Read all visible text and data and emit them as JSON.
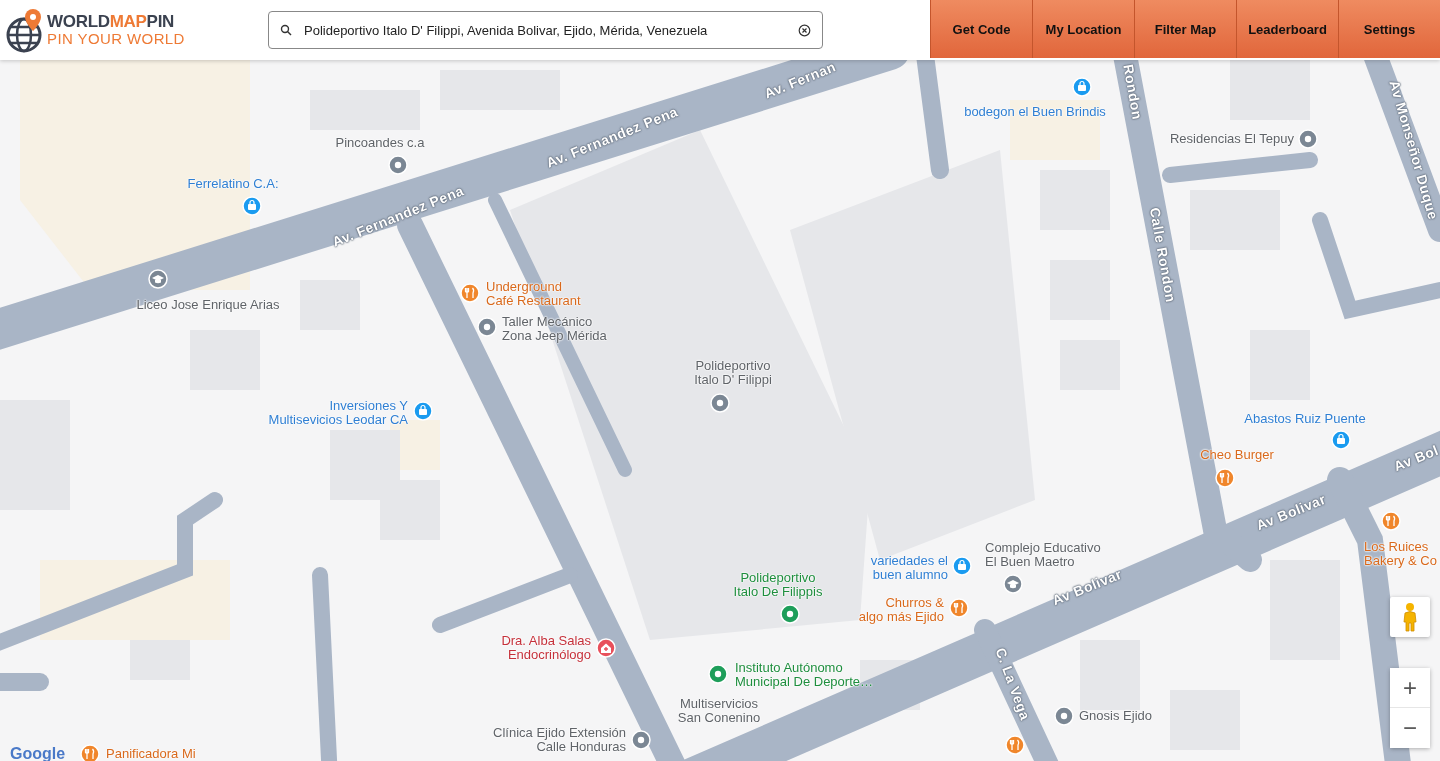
{
  "header": {
    "logo": {
      "brand_dark": "WORLD",
      "brand_accent": "MAP",
      "brand_end": "PIN",
      "tagline": "PIN YOUR WORLD"
    },
    "search": {
      "value": "Polideportivo Italo D' Filippi, Avenida Bolivar, Ejido, Mérida, Venezuela"
    },
    "nav": [
      {
        "label": "Get Code"
      },
      {
        "label": "My Location"
      },
      {
        "label": "Filter Map"
      },
      {
        "label": "Leaderboard"
      },
      {
        "label": "Settings"
      }
    ]
  },
  "map": {
    "road_labels": [
      "Av. Fernandez Pena",
      "Av. Fernandez Pena",
      "Av. Fernan",
      "Rondon",
      "Calle Rondon",
      "Av Monseñor Duque",
      "Av Bolivar",
      "Av Bolivar",
      "Av Bol",
      "C. La Vega"
    ],
    "places": [
      {
        "name": "Pincoandes c.a",
        "kind": "place"
      },
      {
        "name": "Ferrelatino C.A:",
        "kind": "shop"
      },
      {
        "name": "Liceo Jose Enrique Arias",
        "kind": "school"
      },
      {
        "name": "Underground\nCafé Restaurant",
        "kind": "food"
      },
      {
        "name": "Taller Mecánico\nZona Jeep Mérida",
        "kind": "place"
      },
      {
        "name": "Polideportivo\nItalo D' Filippi",
        "kind": "place"
      },
      {
        "name": "Inversiones Y\nMultisevicios Leodar CA",
        "kind": "shop"
      },
      {
        "name": "bodegon el Buen Brindis",
        "kind": "shop"
      },
      {
        "name": "Residencias El Tepuy",
        "kind": "place"
      },
      {
        "name": "Abastos Ruiz Puente",
        "kind": "shop"
      },
      {
        "name": "Cheo Burger",
        "kind": "food"
      },
      {
        "name": "Los Ruices\nBakery & Co",
        "kind": "food"
      },
      {
        "name": "variedades el\nbuen alumno",
        "kind": "shop"
      },
      {
        "name": "Complejo Educativo\nEl Buen Maetro",
        "kind": "school"
      },
      {
        "name": "Polideportivo\nItalo De Filippis",
        "kind": "park"
      },
      {
        "name": "Churros &\nalgo más Ejido",
        "kind": "food"
      },
      {
        "name": "Dra. Alba Salas\nEndocrinólogo",
        "kind": "medical"
      },
      {
        "name": "Instituto Autónomo\nMunicipal De Deporte…",
        "kind": "park"
      },
      {
        "name": "Multiservicios\nSan Conenino",
        "kind": "place"
      },
      {
        "name": "Clínica Ejido Extensión\nCalle Honduras",
        "kind": "place"
      },
      {
        "name": "Gnosis Ejido",
        "kind": "place"
      },
      {
        "name": "Panificadora Mi",
        "kind": "food"
      }
    ],
    "unlabeled_pins": [
      {
        "kind": "food"
      }
    ],
    "attribution": "Google",
    "zoom": {
      "in": "+",
      "out": "−"
    }
  }
}
